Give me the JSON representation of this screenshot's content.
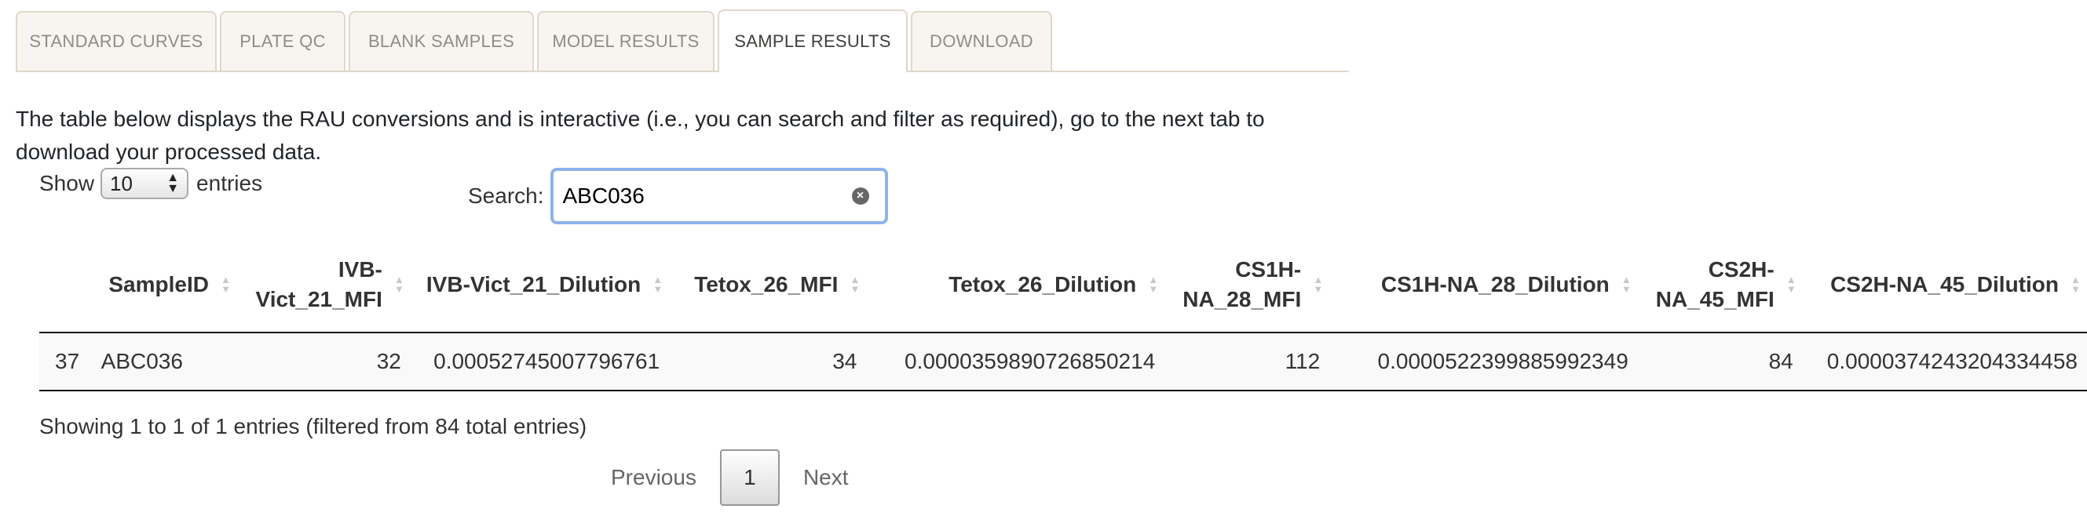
{
  "tabs": [
    {
      "label": "STANDARD CURVES",
      "active": false
    },
    {
      "label": "PLATE QC",
      "active": false
    },
    {
      "label": "BLANK SAMPLES",
      "active": false
    },
    {
      "label": "MODEL RESULTS",
      "active": false
    },
    {
      "label": "SAMPLE RESULTS",
      "active": true
    },
    {
      "label": "DOWNLOAD",
      "active": false
    }
  ],
  "intro_text": "The table below displays the RAU conversions and is interactive (i.e., you can search and filter as required), go to the next tab to download your processed data.",
  "length_control": {
    "show_label": "Show",
    "selected": "10",
    "entries_label": "entries"
  },
  "search": {
    "label": "Search:",
    "value": "ABC036"
  },
  "table": {
    "columns": [
      "",
      "SampleID",
      "IVB-Vict_21_MFI",
      "IVB-Vict_21_Dilution",
      "Tetox_26_MFI",
      "Tetox_26_Dilution",
      "CS1H-NA_28_MFI",
      "CS1H-NA_28_Dilution",
      "CS2H-NA_45_MFI",
      "CS2H-NA_45_Dilution"
    ],
    "rows": [
      [
        "37",
        "ABC036",
        "32",
        "0.00052745007796761",
        "34",
        "0.0000359890726850214",
        "112",
        "0.0000522399885992349",
        "84",
        "0.0000374243204334458"
      ]
    ]
  },
  "info_text": "Showing 1 to 1 of 1 entries (filtered from 84 total entries)",
  "pagination": {
    "previous": "Previous",
    "current_page": "1",
    "next": "Next"
  },
  "colors": {
    "accent_focus": "#8fb2ea",
    "tab_border": "#dfd7ca",
    "tab_bg": "#f8f5f0"
  }
}
